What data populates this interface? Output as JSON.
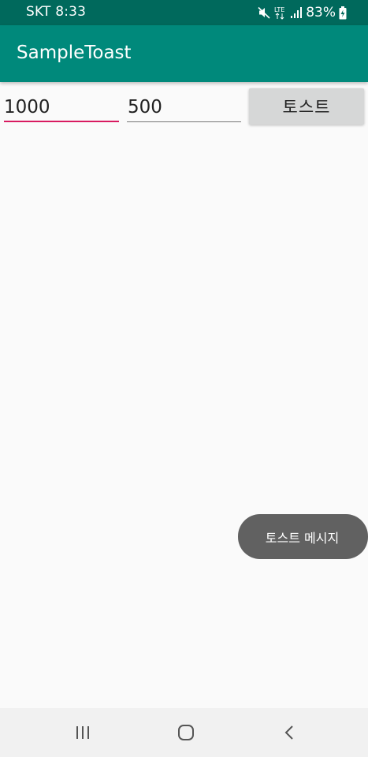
{
  "status_bar": {
    "carrier_time": "SKT 8:33",
    "network_type": "LTE",
    "battery": "83%",
    "icons": [
      "mute-icon",
      "lte-icon",
      "signal-icon",
      "battery-charging-icon"
    ]
  },
  "app_bar": {
    "title": "SampleToast",
    "color": "#00897b",
    "status_color": "#00695c"
  },
  "form": {
    "field1_value": "1000",
    "field2_value": "500",
    "button_label": "토스트",
    "accent_color": "#d81b60"
  },
  "toast": {
    "message": "토스트 메시지"
  },
  "nav_bar": {
    "icons": [
      "recent-apps-icon",
      "home-icon",
      "back-icon"
    ]
  }
}
